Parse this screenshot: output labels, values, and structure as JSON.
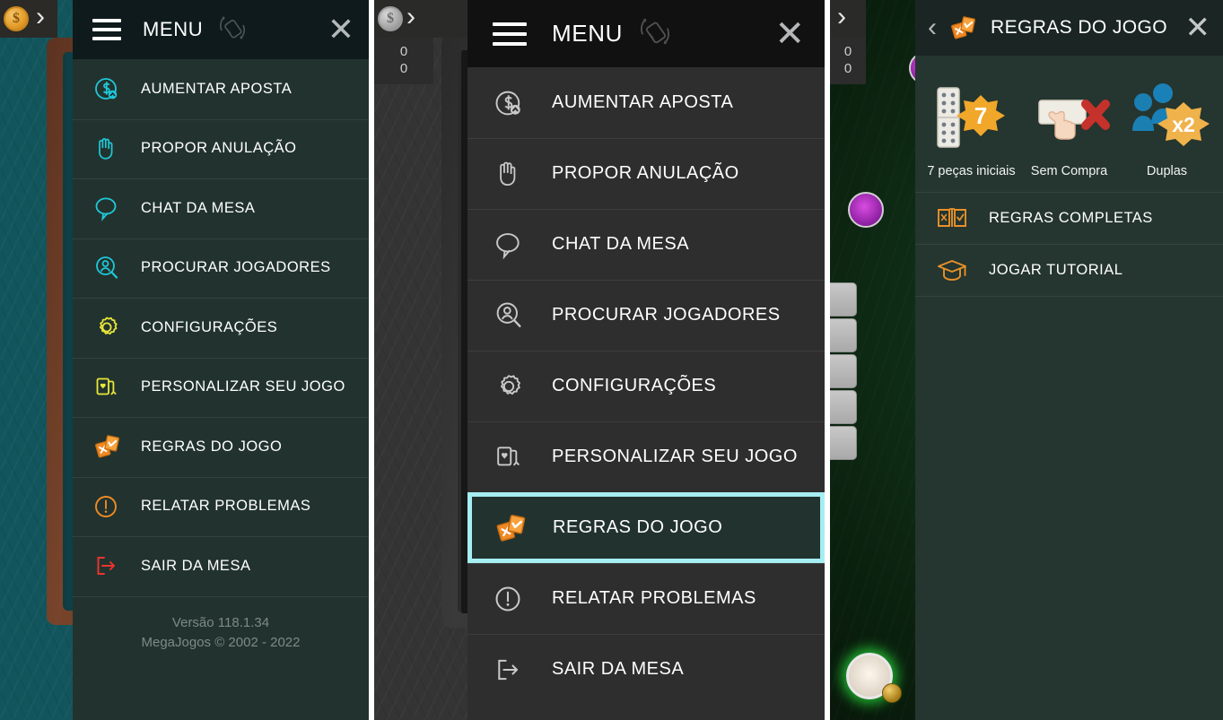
{
  "panel_teal": {
    "hud": {
      "coin_icon": "coin-icon",
      "next_icon": "chevron-right-icon"
    },
    "header": {
      "burger_icon": "hamburger-menu-icon",
      "title": "MENU",
      "rotate_icon": "rotate-device-icon",
      "close_label": "✕"
    },
    "items": [
      {
        "label": "AUMENTAR APOSTA",
        "icon": "money-increase-icon"
      },
      {
        "label": "PROPOR ANULAÇÃO",
        "icon": "hand-stop-icon"
      },
      {
        "label": "CHAT DA MESA",
        "icon": "chat-bubble-icon"
      },
      {
        "label": "PROCURAR JOGADORES",
        "icon": "search-player-icon"
      },
      {
        "label": "CONFIGURAÇÕES",
        "icon": "gear-icon"
      },
      {
        "label": "PERSONALIZAR SEU JOGO",
        "icon": "cards-customize-icon"
      },
      {
        "label": "REGRAS DO JOGO",
        "icon": "rules-cards-icon"
      },
      {
        "label": "RELATAR PROBLEMAS",
        "icon": "alert-circle-icon"
      },
      {
        "label": "SAIR DA MESA",
        "icon": "exit-door-icon"
      }
    ],
    "footer": {
      "version": "Versão 118.1.34",
      "copyright": "MegaJogos © 2002 - 2022"
    }
  },
  "panel_gray": {
    "hud": {
      "coin_icon": "coin-icon",
      "next_icon": "chevron-right-icon",
      "score_top": "0",
      "score_bottom": "0"
    },
    "header": {
      "burger_icon": "hamburger-menu-icon",
      "title": "MENU",
      "rotate_icon": "rotate-device-icon",
      "close_label": "✕"
    },
    "items": [
      {
        "label": "AUMENTAR APOSTA",
        "icon": "money-increase-icon",
        "selected": false
      },
      {
        "label": "PROPOR ANULAÇÃO",
        "icon": "hand-stop-icon",
        "selected": false
      },
      {
        "label": "CHAT DA MESA",
        "icon": "chat-bubble-icon",
        "selected": false
      },
      {
        "label": "PROCURAR JOGADORES",
        "icon": "search-player-icon",
        "selected": false
      },
      {
        "label": "CONFIGURAÇÕES",
        "icon": "gear-icon",
        "selected": false
      },
      {
        "label": "PERSONALIZAR SEU JOGO",
        "icon": "cards-customize-icon",
        "selected": false
      },
      {
        "label": "REGRAS DO JOGO",
        "icon": "rules-cards-icon",
        "selected": true
      },
      {
        "label": "RELATAR PROBLEMAS",
        "icon": "alert-circle-icon",
        "selected": false
      },
      {
        "label": "SAIR DA MESA",
        "icon": "exit-door-icon",
        "selected": false
      }
    ],
    "selection_color": "#a5eef2"
  },
  "panel_rules": {
    "header": {
      "back_label": "‹",
      "icon": "rules-cards-icon",
      "title": "REGRAS DO JOGO",
      "close_label": "✕"
    },
    "badges": [
      {
        "caption": "7 peças iniciais",
        "value": "7",
        "icon": "domino-tiles-icon"
      },
      {
        "caption": "Sem Compra",
        "value": "",
        "icon": "no-draw-icon"
      },
      {
        "caption": "Duplas",
        "value": "x2",
        "icon": "two-players-icon"
      }
    ],
    "items": [
      {
        "label": "REGRAS COMPLETAS",
        "icon": "open-book-icon"
      },
      {
        "label": "JOGAR TUTORIAL",
        "icon": "graduation-cap-icon"
      }
    ],
    "accent_color": "#e8912a"
  }
}
